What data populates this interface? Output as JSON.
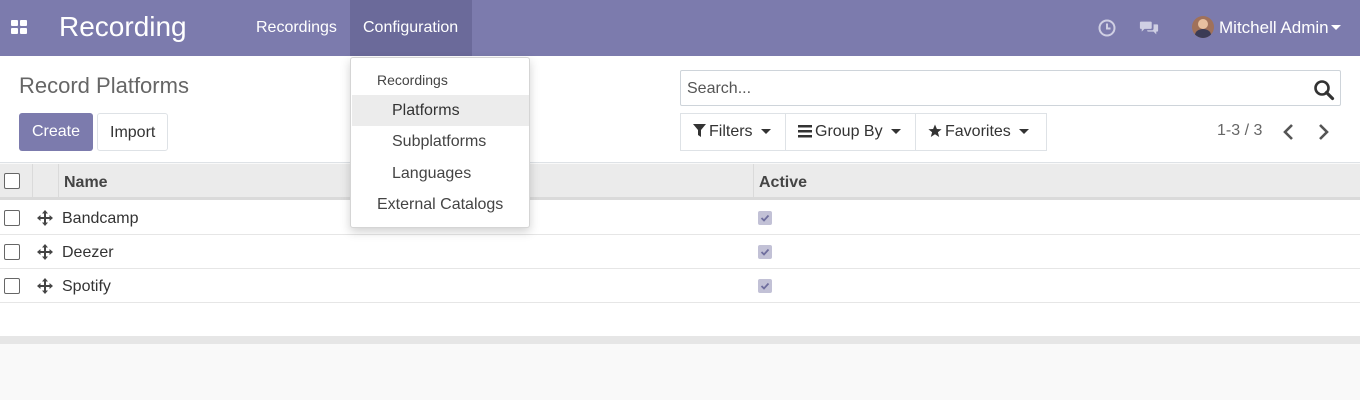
{
  "app": {
    "title": "Recording"
  },
  "nav": {
    "items": [
      {
        "label": "Recordings"
      },
      {
        "label": "Configuration"
      }
    ]
  },
  "user": {
    "name": "Mitchell Admin"
  },
  "icons": {
    "apps": "apps-grid-icon",
    "clock": "clock-icon",
    "chat": "chat-icon",
    "search": "search-icon",
    "filter": "filter-icon",
    "groupby": "list-icon",
    "favorites": "star-icon",
    "drag": "drag-handle-icon",
    "prev": "chevron-left-icon",
    "next": "chevron-right-icon"
  },
  "colors": {
    "primary": "#7c7bad",
    "nav_active": "#6b6a9a",
    "check_fill": "#c2c1d6"
  },
  "control_panel": {
    "title": "Record Platforms",
    "create_label": "Create",
    "import_label": "Import",
    "search_placeholder": "Search...",
    "filters_label": "Filters",
    "groupby_label": "Group By",
    "favorites_label": "Favorites",
    "pager": "1-3 / 3"
  },
  "list": {
    "columns": [
      {
        "label": "Name"
      },
      {
        "label": "Active"
      }
    ],
    "rows": [
      {
        "name": "Bandcamp",
        "active": true
      },
      {
        "name": "Deezer",
        "active": true
      },
      {
        "name": "Spotify",
        "active": true
      }
    ]
  },
  "dropdown": {
    "header": "Recordings",
    "items": [
      {
        "label": "Platforms",
        "highlighted": true
      },
      {
        "label": "Subplatforms",
        "highlighted": false
      },
      {
        "label": "Languages",
        "highlighted": false
      },
      {
        "label": "External Catalogs",
        "highlighted": false
      }
    ]
  }
}
